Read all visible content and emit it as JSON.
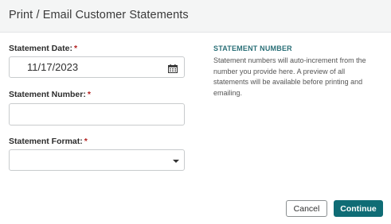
{
  "dialog": {
    "title": "Print / Email Customer Statements"
  },
  "form": {
    "statement_date": {
      "label": "Statement Date:",
      "required_mark": "*",
      "value": "11/17/2023"
    },
    "statement_number": {
      "label": "Statement Number:",
      "required_mark": "*",
      "value": ""
    },
    "statement_format": {
      "label": "Statement Format:",
      "required_mark": "*",
      "selected": ""
    }
  },
  "help": {
    "heading": "STATEMENT NUMBER",
    "text": "Statement numbers will auto-increment from the number you provide here. A preview of all statements will be available before printing and emailing."
  },
  "footer": {
    "cancel_label": "Cancel",
    "continue_label": "Continue"
  },
  "colors": {
    "accent": "#0f6c75",
    "required": "#b3201f"
  },
  "icons": {
    "date_picker": "calendar-icon",
    "select_toggle": "caret-down-icon"
  }
}
